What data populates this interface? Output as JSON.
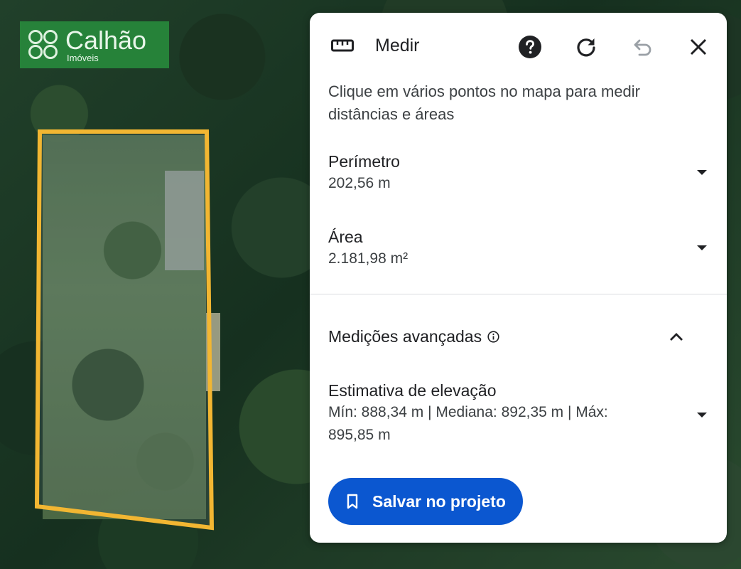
{
  "logo": {
    "name": "Calhão",
    "sub": "Imóveis"
  },
  "panel": {
    "title": "Medir",
    "title_icon": "ruler-icon",
    "header_buttons": [
      "help-icon",
      "reset-icon",
      "undo-icon",
      "close-icon"
    ],
    "hint": "Clique em vários pontos no mapa para medir distâncias e áreas",
    "perimeter": {
      "label": "Perímetro",
      "value": "202,56 m"
    },
    "area": {
      "label": "Área",
      "value": "2.181,98 m²"
    },
    "advanced": {
      "label": "Medições avançadas"
    },
    "elevation": {
      "label": "Estimativa de elevação",
      "value": "Mín: 888,34 m | Mediana: 892,35 m | Máx: 895,85 m"
    },
    "save_label": "Salvar no projeto",
    "save_icon": "bookmark-icon"
  },
  "colors": {
    "accent": "#0b57d0",
    "polygon": "#f2b632"
  }
}
